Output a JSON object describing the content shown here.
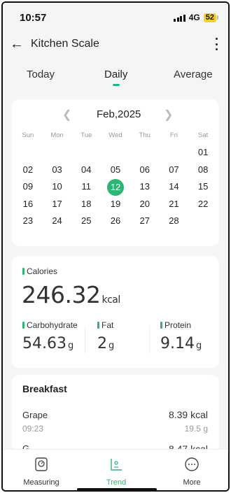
{
  "status_bar": {
    "time": "10:57",
    "network": "4G",
    "battery": "52"
  },
  "app_bar": {
    "title": "Kitchen Scale"
  },
  "tabs": [
    {
      "label": "Today"
    },
    {
      "label": "Daily",
      "selected": true
    },
    {
      "label": "Average"
    }
  ],
  "calendar": {
    "month": "Feb,2025",
    "weekdays": [
      "Sun",
      "Mon",
      "Tue",
      "Wed",
      "Thu",
      "Fri",
      "Sat"
    ],
    "weeks": [
      [
        "",
        "",
        "",
        "",
        "",
        "",
        "01"
      ],
      [
        "02",
        "03",
        "04",
        "05",
        "06",
        "07",
        "08"
      ],
      [
        "09",
        "10",
        "11",
        "12",
        "13",
        "14",
        "15"
      ],
      [
        "16",
        "17",
        "18",
        "19",
        "20",
        "21",
        "22"
      ],
      [
        "23",
        "24",
        "25",
        "26",
        "27",
        "28",
        ""
      ]
    ],
    "selected_day": "12"
  },
  "nutrition": {
    "calories_label": "Calories",
    "calories_value": "246.32",
    "calories_unit": "kcal",
    "macros": [
      {
        "label": "Carbohydrate",
        "value": "54.63",
        "unit": "g"
      },
      {
        "label": "Fat",
        "value": "2",
        "unit": "g"
      },
      {
        "label": "Protein",
        "value": "9.14",
        "unit": "g"
      }
    ]
  },
  "breakfast": {
    "title": "Breakfast",
    "items": [
      {
        "name": "Grape",
        "kcal": "8.39 kcal",
        "time": "09:23",
        "weight": "19.5 g"
      },
      {
        "name": "G...",
        "kcal": "8.47 kcal"
      }
    ]
  },
  "bottom_nav": [
    {
      "label": "Measuring",
      "icon": "scale-icon"
    },
    {
      "label": "Trend",
      "icon": "trend-icon",
      "active": true
    },
    {
      "label": "More",
      "icon": "more-icon"
    }
  ],
  "colors": {
    "accent": "#2bb673",
    "battery": "#f2d12e"
  }
}
